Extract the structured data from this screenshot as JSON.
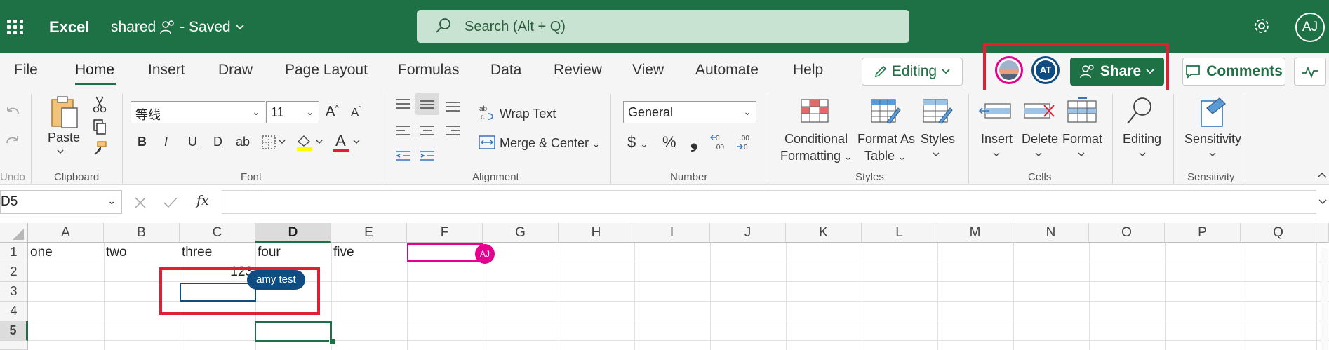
{
  "topbar": {
    "app_name": "Excel",
    "doc_title": "shared",
    "doc_status": "- Saved",
    "search_placeholder": "Search (Alt + Q)",
    "user_initials": "AJ"
  },
  "tabs": [
    "File",
    "Home",
    "Insert",
    "Draw",
    "Page Layout",
    "Formulas",
    "Data",
    "Review",
    "View",
    "Automate",
    "Help"
  ],
  "active_tab": "Home",
  "actions": {
    "editing_label": "Editing",
    "presence_initials": "AT",
    "share_label": "Share",
    "comments_label": "Comments"
  },
  "ribbon": {
    "undo_label": "Undo",
    "paste_label": "Paste",
    "groups": {
      "clipboard": "Clipboard",
      "font": "Font",
      "alignment": "Alignment",
      "number": "Number",
      "styles": "Styles",
      "cells": "Cells",
      "sensitivity": "Sensitivity"
    },
    "font_name": "等线",
    "font_size": "11",
    "bold": "B",
    "italic": "I",
    "underline": "U",
    "double_underline": "D",
    "strikethrough": "ab",
    "font_color_glyph": "A",
    "wrap_text": "Wrap Text",
    "merge_center": "Merge & Center",
    "number_format": "General",
    "currency": "$",
    "percent": "%",
    "comma": "❟",
    "conditional_formatting_1": "Conditional",
    "conditional_formatting_2": "Formatting",
    "format_as_table_1": "Format As",
    "format_as_table_2": "Table",
    "styles_btn": "Styles",
    "insert_btn": "Insert",
    "delete_btn": "Delete",
    "format_btn": "Format",
    "editing_btn": "Editing",
    "sensitivity_btn": "Sensitivity"
  },
  "formula_bar": {
    "name_box": "D5",
    "fx": "fx",
    "formula": ""
  },
  "grid": {
    "columns": [
      "A",
      "B",
      "C",
      "D",
      "E",
      "F",
      "G",
      "H",
      "I",
      "J",
      "K",
      "L",
      "M",
      "N",
      "O",
      "P",
      "Q"
    ],
    "rows": [
      "1",
      "2",
      "3",
      "4",
      "5"
    ],
    "selected_column": "D",
    "selected_row": "5",
    "cells": {
      "A1": "one",
      "B1": "two",
      "C1": "three",
      "D1": "four",
      "E1": "five",
      "C2": "123"
    },
    "collaborators": {
      "aj_badge": "AJ",
      "amy_label": "amy test"
    }
  },
  "colors": {
    "brand": "#1e7145",
    "aj_presence": "#e3008c",
    "amy_presence": "#0f4c81",
    "highlight_box": "#e02030"
  }
}
